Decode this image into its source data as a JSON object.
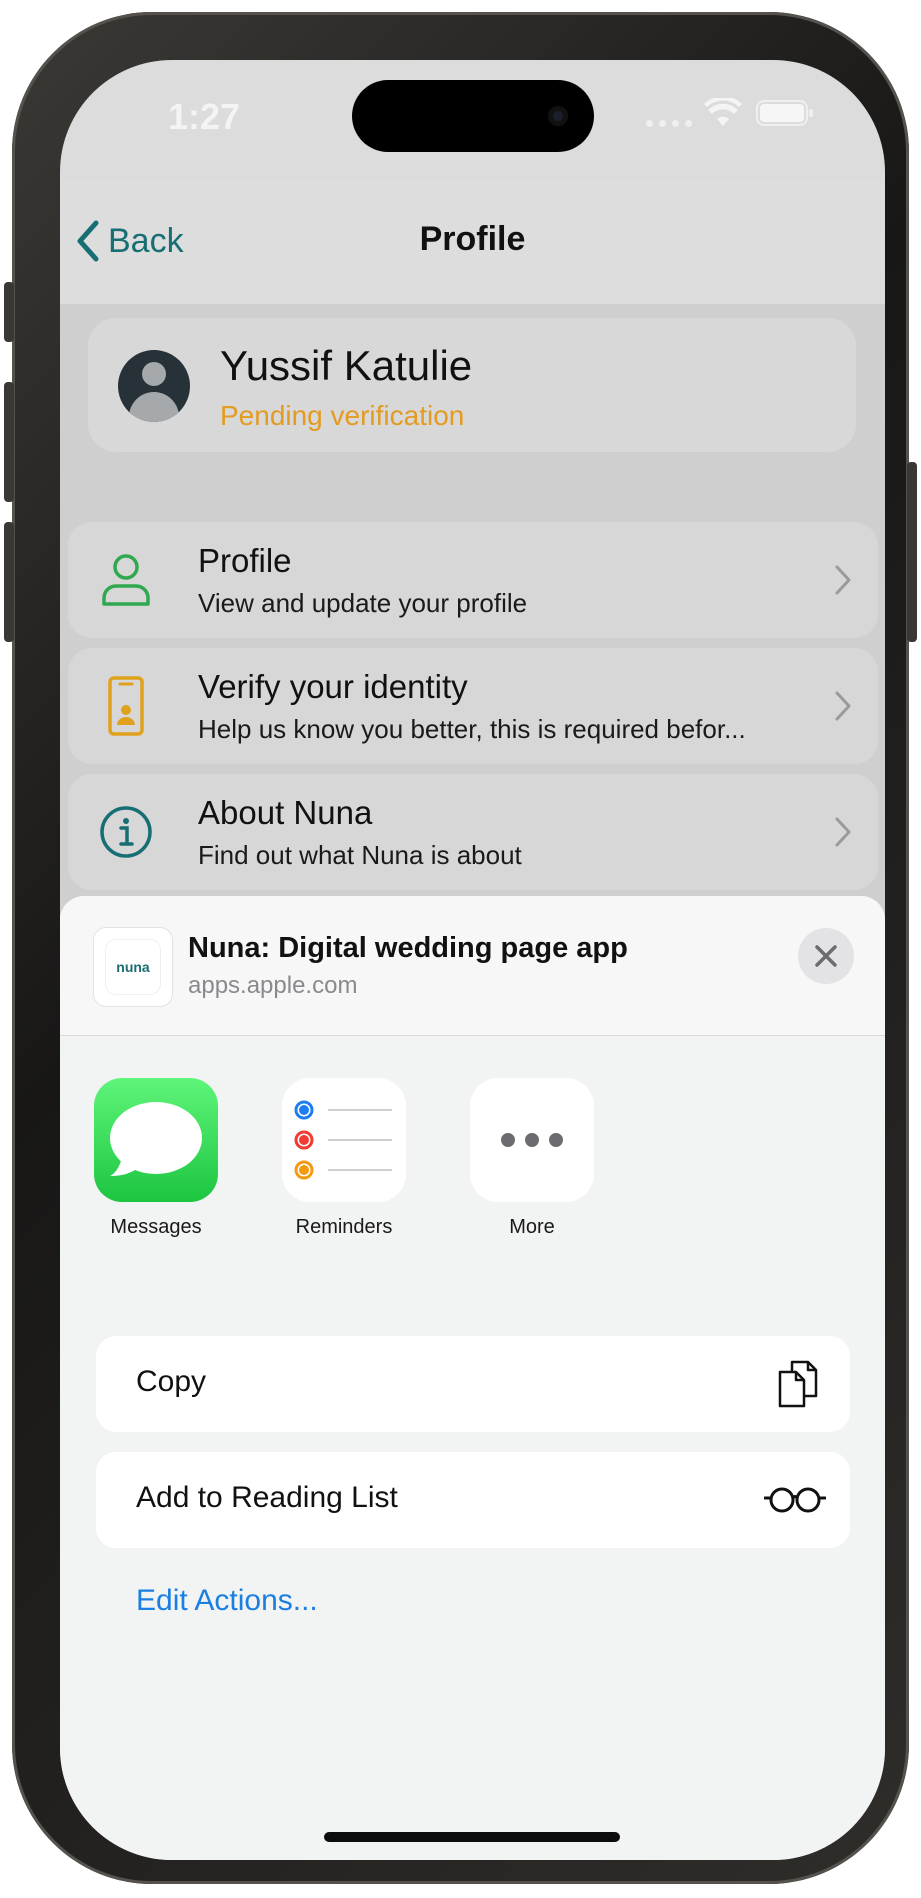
{
  "status_bar": {
    "time": "1:27"
  },
  "nav": {
    "back_label": "Back",
    "title": "Profile"
  },
  "user": {
    "name": "Yussif Katulie",
    "status": "Pending verification"
  },
  "menu": [
    {
      "title": "Profile",
      "subtitle": "View and update your profile",
      "icon": "person-icon"
    },
    {
      "title": "Verify your identity",
      "subtitle": "Help us know you better, this is required befor...",
      "icon": "phone-id-icon"
    },
    {
      "title": "About Nuna",
      "subtitle": "Find out what Nuna is about",
      "icon": "info-icon"
    }
  ],
  "share_sheet": {
    "title": "Nuna: Digital wedding page app",
    "url": "apps.apple.com",
    "app_thumb_text": "nuna",
    "apps": [
      {
        "label": "Messages",
        "icon": "messages-icon"
      },
      {
        "label": "Reminders",
        "icon": "reminders-icon"
      },
      {
        "label": "More",
        "icon": "more-icon"
      }
    ],
    "actions": [
      {
        "label": "Copy",
        "icon": "copy-icon"
      },
      {
        "label": "Add to Reading List",
        "icon": "glasses-icon"
      }
    ],
    "edit_actions_label": "Edit Actions..."
  },
  "colors": {
    "accent_teal": "#176e73",
    "pending_orange": "#e39b21",
    "link_blue": "#1a7fe0",
    "messages_green": "#2fd158"
  }
}
